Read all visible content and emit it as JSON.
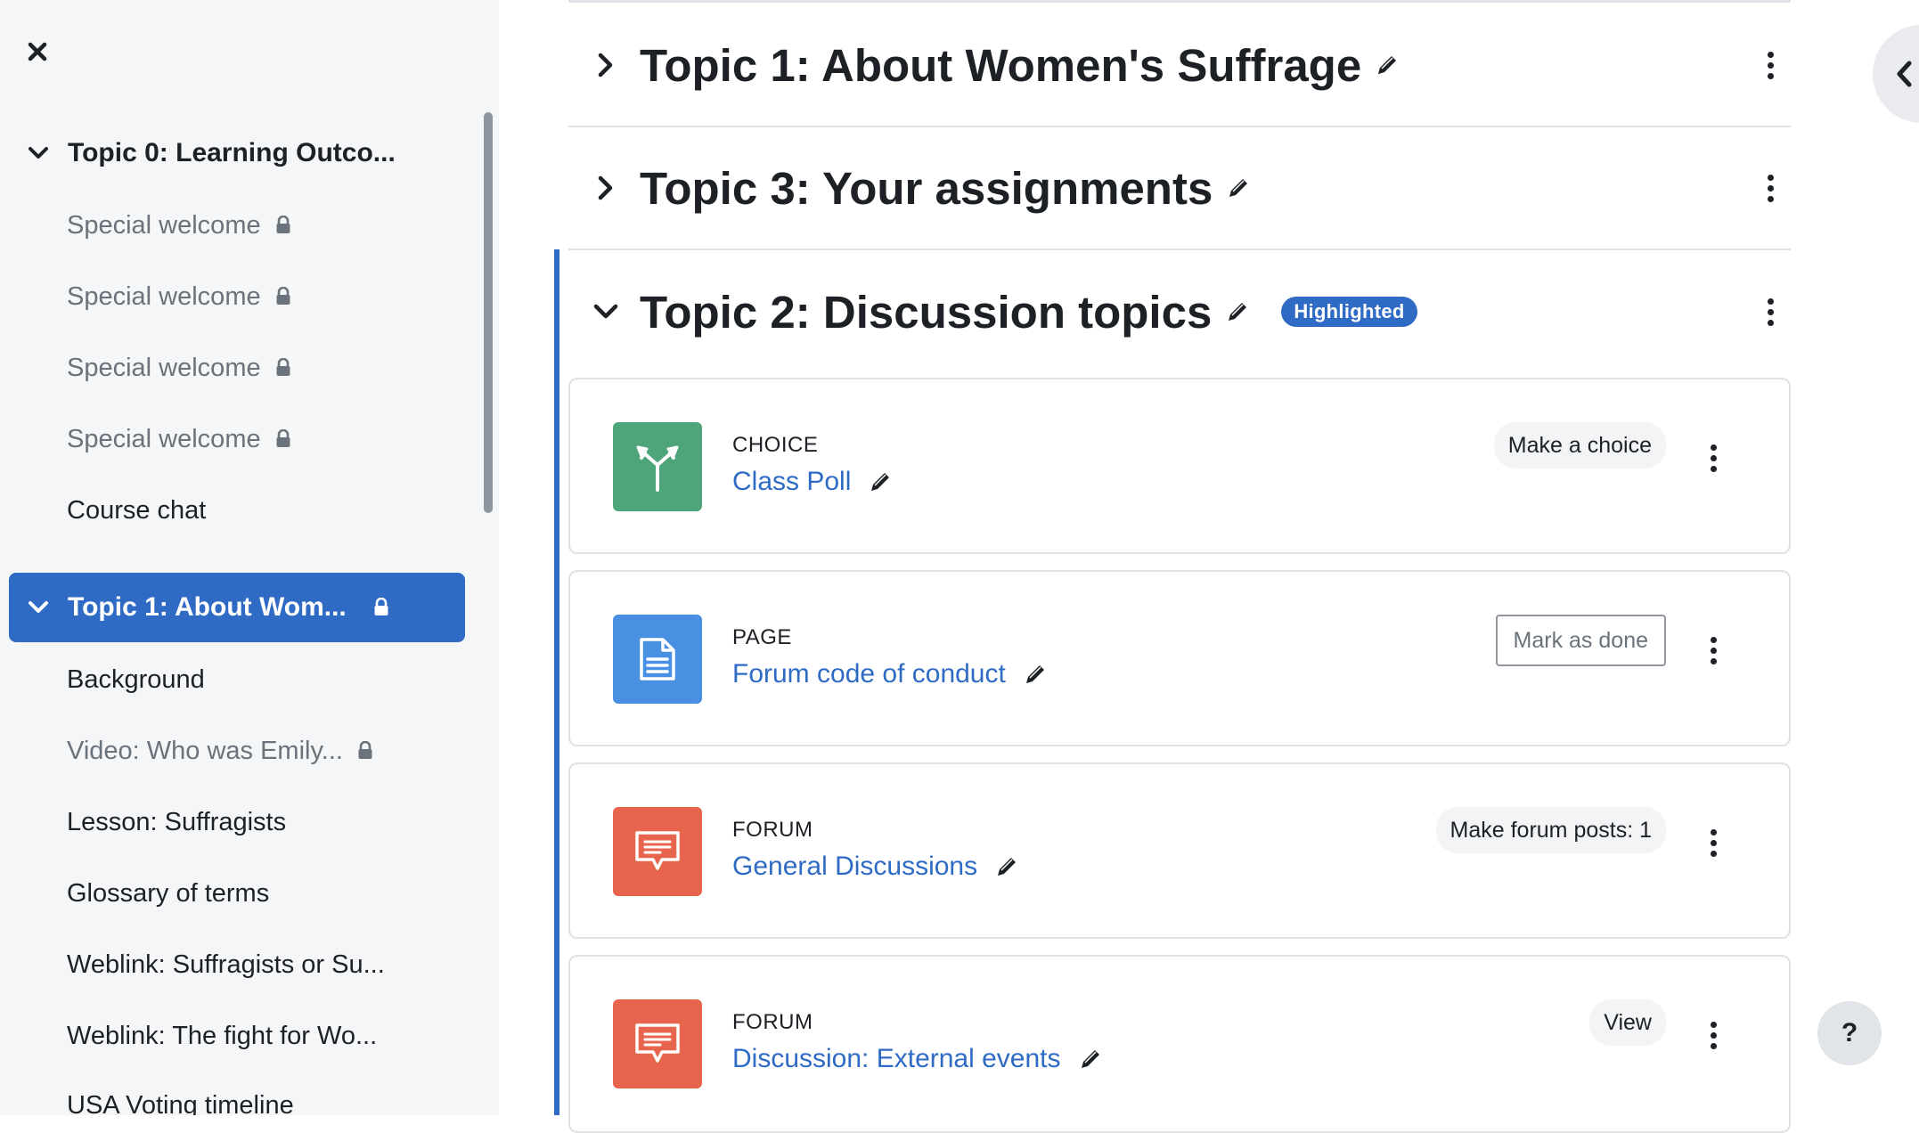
{
  "sidebar": {
    "close_icon": "close-icon",
    "sections": [
      {
        "label": "Topic 0: Learning Outco...",
        "expanded": true,
        "active": false,
        "locked": false
      },
      {
        "label": "Topic 1: About Wom...",
        "expanded": true,
        "active": true,
        "locked": true
      }
    ],
    "section0_items": [
      {
        "label": "Special welcome",
        "locked": true
      },
      {
        "label": "Special welcome",
        "locked": true
      },
      {
        "label": "Special welcome",
        "locked": true
      },
      {
        "label": "Special welcome",
        "locked": true
      },
      {
        "label": "Course chat",
        "locked": false
      }
    ],
    "section1_items": [
      {
        "label": "Background",
        "locked": false
      },
      {
        "label": "Video: Who was Emily...",
        "locked": true
      },
      {
        "label": "Lesson: Suffragists",
        "locked": false
      },
      {
        "label": "Glossary of terms",
        "locked": false
      },
      {
        "label": "Weblink: Suffragists or Su...",
        "locked": false
      },
      {
        "label": "Weblink: The fight for Wo...",
        "locked": false
      },
      {
        "label": "USA Voting timeline",
        "locked": false
      }
    ]
  },
  "main": {
    "topics": [
      {
        "title": "Topic 1: About Women's Suffrage",
        "expanded": false
      },
      {
        "title": "Topic 3: Your assignments",
        "expanded": false
      },
      {
        "title": "Topic 2: Discussion topics",
        "expanded": true,
        "badge": "Highlighted"
      }
    ],
    "activities": [
      {
        "type": "CHOICE",
        "name": "Class Poll",
        "action": "Make a choice",
        "action_style": "pill",
        "icon": "choice-icon",
        "color": "#4fa57a"
      },
      {
        "type": "PAGE",
        "name": "Forum code of conduct",
        "action": "Mark as done",
        "action_style": "outline",
        "icon": "page-icon",
        "color": "#4a90e2"
      },
      {
        "type": "FORUM",
        "name": "General Discussions",
        "action": "Make forum posts: 1",
        "action_style": "pill",
        "icon": "forum-icon",
        "color": "#e8654d"
      },
      {
        "type": "FORUM",
        "name": "Discussion: External events",
        "action": "View",
        "action_style": "pill",
        "icon": "forum-icon",
        "color": "#e8654d"
      }
    ]
  },
  "help": {
    "label": "?"
  },
  "colors": {
    "accent": "#2f6bc4",
    "sidebar_bg": "#f5f6f7"
  }
}
